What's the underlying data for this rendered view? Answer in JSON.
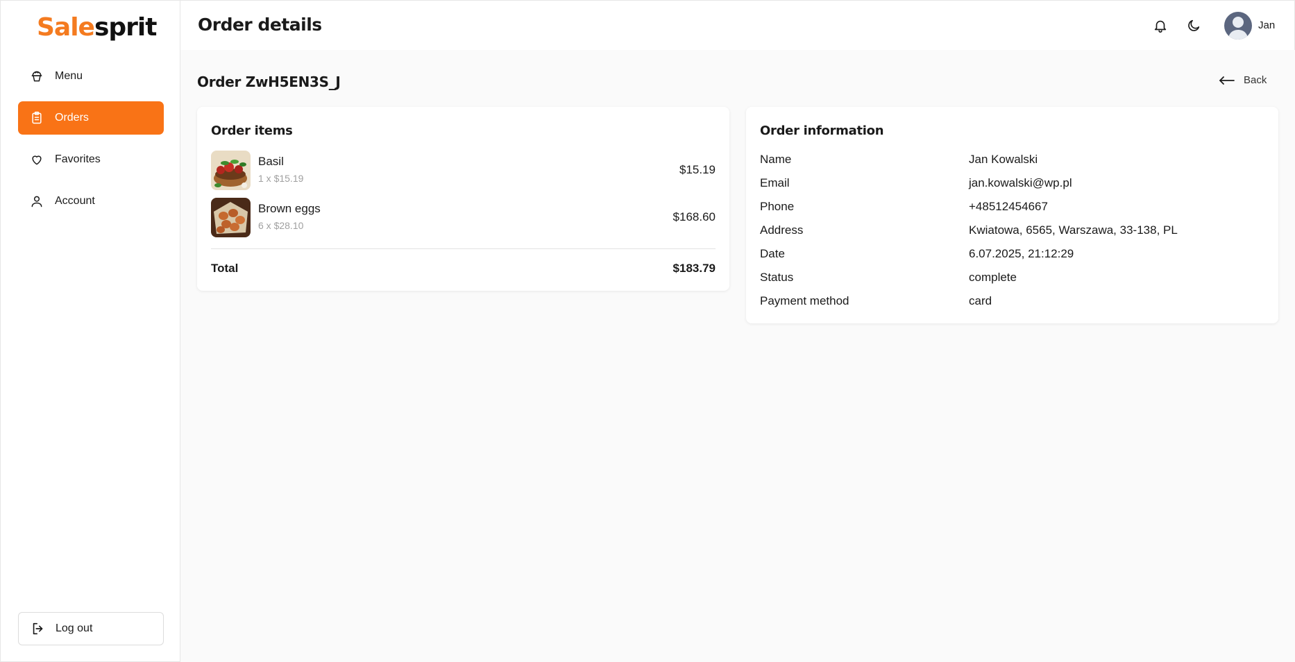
{
  "brand": {
    "part1": "Sale",
    "part2": "sprit",
    "accent": "#f47b20"
  },
  "sidebar": {
    "items": [
      {
        "label": "Menu",
        "icon": "cake-icon"
      },
      {
        "label": "Orders",
        "icon": "clipboard-icon"
      },
      {
        "label": "Favorites",
        "icon": "heart-icon"
      },
      {
        "label": "Account",
        "icon": "user-icon"
      }
    ],
    "logout_label": "Log out"
  },
  "header": {
    "title": "Order details",
    "user_name": "Jan"
  },
  "order": {
    "heading": "Order ZwH5EN3S_J",
    "back_label": "Back"
  },
  "order_items": {
    "title": "Order items",
    "items": [
      {
        "name": "Basil",
        "qty": "1 x $15.19",
        "price": "$15.19"
      },
      {
        "name": "Brown eggs",
        "qty": "6 x $28.10",
        "price": "$168.60"
      }
    ],
    "total_label": "Total",
    "total_value": "$183.79"
  },
  "order_info": {
    "title": "Order information",
    "rows": [
      {
        "label": "Name",
        "value": "Jan Kowalski"
      },
      {
        "label": "Email",
        "value": "jan.kowalski@wp.pl"
      },
      {
        "label": "Phone",
        "value": "+48512454667"
      },
      {
        "label": "Address",
        "value": "Kwiatowa, 6565, Warszawa, 33-138, PL"
      },
      {
        "label": "Date",
        "value": "6.07.2025, 21:12:29"
      },
      {
        "label": "Status",
        "value": "complete"
      },
      {
        "label": "Payment method",
        "value": "card"
      }
    ]
  }
}
